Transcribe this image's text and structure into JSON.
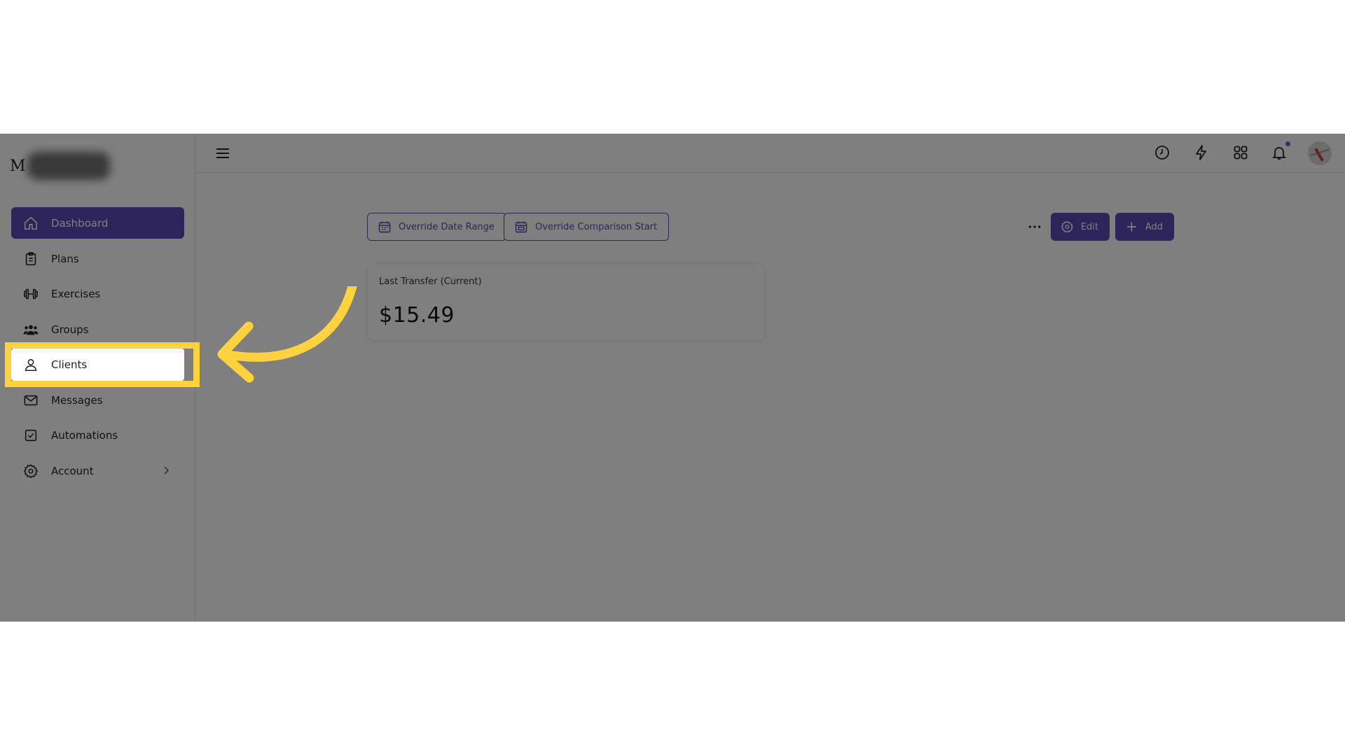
{
  "app": {
    "logo_letter": "M",
    "accent_color": "#5b4bb5",
    "highlight_color": "#ffd23f"
  },
  "sidebar": {
    "items": [
      {
        "label": "Dashboard",
        "icon": "home-icon",
        "active": true
      },
      {
        "label": "Plans",
        "icon": "clipboard-icon"
      },
      {
        "label": "Exercises",
        "icon": "dumbbell-icon"
      },
      {
        "label": "Groups",
        "icon": "users-icon"
      },
      {
        "label": "Clients",
        "icon": "user-icon",
        "highlighted": true
      },
      {
        "label": "Messages",
        "icon": "mail-icon"
      },
      {
        "label": "Automations",
        "icon": "check-square-icon"
      },
      {
        "label": "Account",
        "icon": "gear-icon",
        "has_submenu": true
      }
    ]
  },
  "topbar": {
    "icons": [
      "menu-icon",
      "clock-icon",
      "lightning-icon",
      "grid-icon",
      "bell-icon",
      "avatar"
    ],
    "notification_dot": true
  },
  "toolbar": {
    "override_date_range": "Override Date Range",
    "override_comparison_start": "Override Comparison Start",
    "edit": "Edit",
    "add": "Add"
  },
  "card": {
    "title": "Last Transfer (Current)",
    "value": "$15.49"
  }
}
